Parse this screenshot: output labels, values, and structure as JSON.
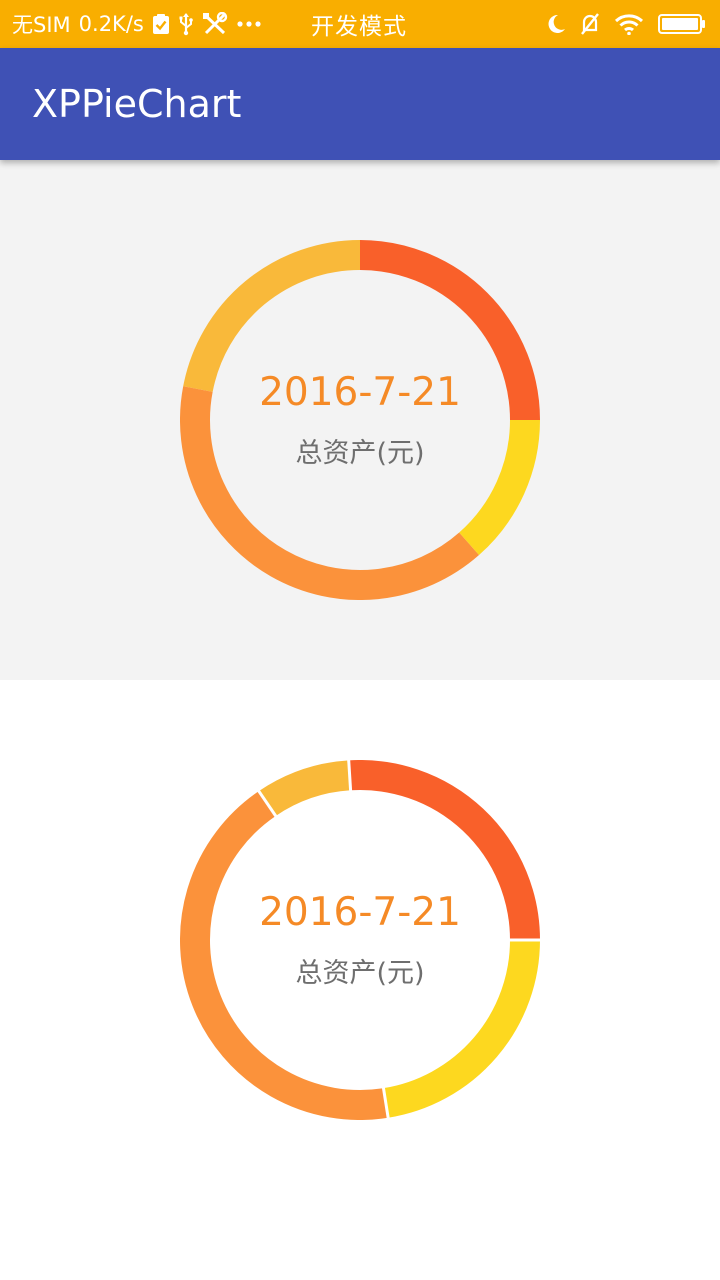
{
  "status_bar": {
    "carrier": "无SIM",
    "speed": "0.2K/s",
    "mode": "开发模式",
    "background": "#f9ae00",
    "icons": [
      "checklist-icon",
      "usb-icon",
      "tools-icon",
      "more-dots-icon",
      "moon-icon",
      "muted-bell-icon",
      "wifi-icon",
      "battery-icon"
    ]
  },
  "app_bar": {
    "title": "XPPieChart",
    "background": "#3f51b5"
  },
  "chart_data": [
    {
      "type": "pie",
      "style": "donut",
      "center_title": "2016-7-21",
      "center_subtitle": "总资产(元)",
      "background": "#f3f3f3",
      "gap_between_slices": false,
      "slices": [
        {
          "percent": 25.0,
          "color": "#f9602a"
        },
        {
          "percent": 22.0,
          "color": "#f9b93a"
        },
        {
          "percent": 39.5,
          "color": "#fb923b"
        },
        {
          "percent": 13.5,
          "color": "#fdd81f"
        }
      ]
    },
    {
      "type": "pie",
      "style": "donut",
      "center_title": "2016-7-21",
      "center_subtitle": "总资产(元)",
      "background": "#ffffff",
      "gap_between_slices": true,
      "slices": [
        {
          "percent": 26.0,
          "color": "#f9602a"
        },
        {
          "percent": 8.5,
          "color": "#f9b93a"
        },
        {
          "percent": 43.0,
          "color": "#fb923b"
        },
        {
          "percent": 22.5,
          "color": "#fdd81f"
        }
      ]
    }
  ]
}
